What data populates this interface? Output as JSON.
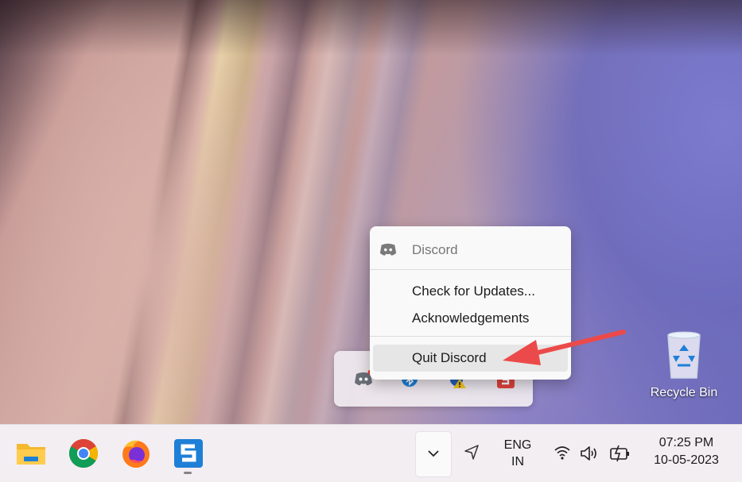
{
  "desktop": {
    "recycle_bin_label": "Recycle Bin"
  },
  "context_menu": {
    "app_name": "Discord",
    "items": [
      {
        "label": "Check for Updates..."
      },
      {
        "label": "Acknowledgements"
      },
      {
        "label": "Quit Discord"
      }
    ],
    "highlighted_item": "Quit Discord"
  },
  "tray_overflow": {
    "icons": [
      "discord-icon",
      "bluetooth-icon",
      "security-warning-icon",
      "snagit-icon"
    ]
  },
  "taskbar": {
    "apps": [
      "file-explorer-icon",
      "chrome-icon",
      "firefox-icon",
      "snagit-icon"
    ],
    "language": {
      "line1": "ENG",
      "line2": "IN"
    },
    "clock": {
      "time": "07:25 PM",
      "date": "10-05-2023"
    }
  },
  "colors": {
    "annotation_arrow": "#ec4a4a",
    "discord_badge": "#e0413c"
  }
}
